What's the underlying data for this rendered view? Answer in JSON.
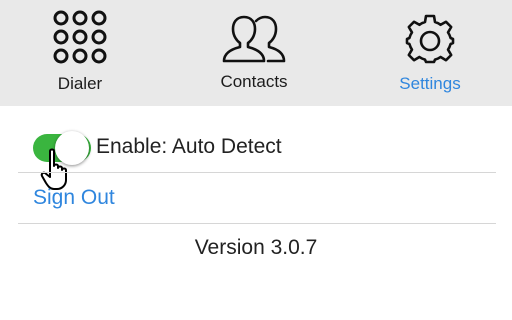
{
  "nav": {
    "tabs": [
      {
        "label": "Dialer",
        "icon": "dialpad-icon"
      },
      {
        "label": "Contacts",
        "icon": "contacts-icon"
      },
      {
        "label": "Settings",
        "icon": "gear-icon"
      }
    ],
    "active_tab": "Settings"
  },
  "settings": {
    "auto_detect": {
      "label": "Enable: Auto Detect",
      "enabled": true
    },
    "sign_out_label": "Sign Out",
    "version": "Version 3.0.7"
  },
  "colors": {
    "nav_background": "#e9e9e9",
    "accent": "#2f86de",
    "toggle_on": "#3ab53f"
  }
}
